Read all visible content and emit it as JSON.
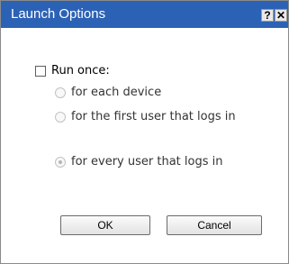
{
  "window": {
    "title": "Launch Options",
    "help_glyph": "?",
    "close_glyph": "✕"
  },
  "run_once": {
    "label": "Run once:",
    "checked": false
  },
  "options": [
    {
      "label": "for each device",
      "selected": false,
      "enabled": false
    },
    {
      "label": "for the first user that logs in",
      "selected": false,
      "enabled": false
    },
    {
      "label": "for every user that logs in",
      "selected": true,
      "enabled": false
    }
  ],
  "buttons": {
    "ok": "OK",
    "cancel": "Cancel"
  },
  "colors": {
    "titlebar": "#2c62b5"
  }
}
